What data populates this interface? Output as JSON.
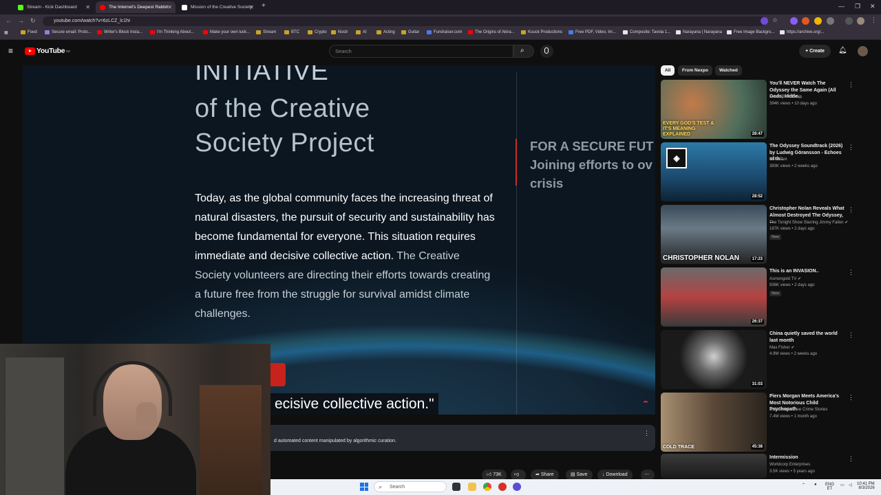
{
  "browser": {
    "tabs": [
      {
        "title": "Stream - Kick Dashboard",
        "favicon_color": "#53fc18",
        "active": false
      },
      {
        "title": "The Internet's Deepest Rabbit",
        "favicon_color": "#ff0000",
        "active": true
      },
      {
        "title": "Mission of the Creative Society",
        "favicon_color": "#ffffff",
        "active": false
      }
    ],
    "url": "youtube.com/watch?v=6zLCZ_lc1hI",
    "bookmarks": [
      "Food",
      "Secure email: Proto...",
      "Writer's Block Insta...",
      "I'm Thinking About...",
      "Make your own luck...",
      "Stream",
      "BTC",
      "Crypto",
      "Nostr",
      "AI",
      "Acting",
      "Guitar",
      "Fundraiser.com",
      "The Origins of Akira...",
      "Kuuck Productions",
      "Free PDF, Video, Im...",
      "Composite: Tavola 1...",
      "Narayana | Narayana",
      "Free Image Backgro...",
      "https://archive.org/..."
    ]
  },
  "youtube": {
    "logo": "YouTube",
    "region": "EE",
    "search_placeholder": "Search",
    "create_label": "Create"
  },
  "video": {
    "title_line0": "INITIATIVE",
    "title_line1": "of the Creative",
    "title_line2": "Society Project",
    "para_bright": "Today, as the global community faces the increasing threat of natural disasters, the pursuit of security and sustainability has become fundamental for everyone. This situation requires immediate and decisive collective action.",
    "para_dim": " The Creative Society volunteers are directing their efforts towards creating a future free from the struggle for survival amidst climate challenges.",
    "right_line1": "FOR A SECURE FUT",
    "right_line2": "Joining efforts to ov",
    "right_line3": "crisis",
    "caption": "ecisive collective action.\""
  },
  "description": {
    "text": "d automated content manipulated by algorithmic curation."
  },
  "actions": {
    "likes": "73K",
    "share": "Share",
    "save": "Save",
    "download": "Download"
  },
  "taskbar": {
    "search": "Search",
    "lang": "ENG",
    "region": "ET",
    "time": "10:41 PM",
    "date": "8/3/2026"
  },
  "sidebar": {
    "chips": [
      "All",
      "From Nexpo",
      "Watched"
    ],
    "recs": [
      {
        "title": "You'll NEVER Watch The Odyssey the Same Again (All Gods, Hidde...",
        "channel": "Movie Balls Deep",
        "meta": "394K views • 10 days ago",
        "duration": "28:47",
        "thumb_text": "EVERY GOD'S TEST & IT'S MEANING EXPLAINED",
        "new": "",
        "verified": false
      },
      {
        "title": "The Odyssey Soundtrack (2026) by Ludwig Göransson - Echoes of th...",
        "channel": "Kaka Box",
        "meta": "383K views • 2 weeks ago",
        "duration": "28:52",
        "thumb_text": "",
        "new": "",
        "verified": false
      },
      {
        "title": "Christopher Nolan Reveals What Almost Destroyed The Odyssey, ...",
        "channel": "The Tonight Show Starring Jimmy Fallon",
        "meta": "187K views • 2 days ago",
        "duration": "17:23",
        "thumb_text": "CHRISTOPHER NOLAN",
        "new": "New",
        "verified": true
      },
      {
        "title": "This is an INVASION..",
        "channel": "Asmongold TV",
        "meta": "936K views • 2 days ago",
        "duration": "26:37",
        "thumb_text": "",
        "new": "New",
        "verified": true
      },
      {
        "title": "China quietly saved the world last month",
        "channel": "Max Fisher",
        "meta": "4.9M views • 2 weeks ago",
        "duration": "31:03",
        "thumb_text": "",
        "new": "",
        "verified": true
      },
      {
        "title": "Piers Morgan Meets America's Most Notorious Child Psychopath",
        "channel": "Cold Trace - True Crime Stories",
        "meta": "7.4M views • 1 month ago",
        "duration": "45:38",
        "thumb_text": "COLD TRACE",
        "new": "",
        "verified": false
      },
      {
        "title": "Intermission",
        "channel": "Worldcorp Enterprises",
        "meta": "3.5K views • 5 years ago",
        "duration": "",
        "thumb_text": "",
        "new": "",
        "verified": false
      }
    ]
  },
  "colors": {
    "bg": "#0f0f0f",
    "youtube_red": "#ff0000",
    "video_accent_red": "#c9302c",
    "chrome_dark": "#1f1b24"
  }
}
